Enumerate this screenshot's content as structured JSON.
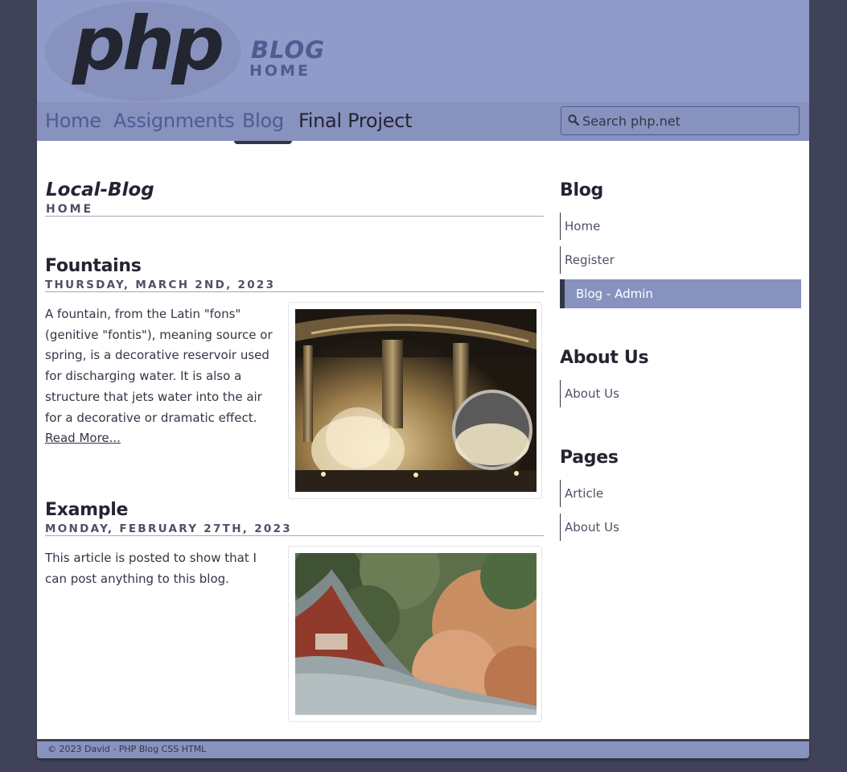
{
  "header": {
    "logo_text": "php",
    "title": "BLOG",
    "subtitle": "HOME"
  },
  "nav": {
    "items": [
      {
        "label": "Home"
      },
      {
        "label": "Assignments"
      },
      {
        "label": "Blog"
      },
      {
        "label": "Final Project"
      }
    ],
    "active": "Blog",
    "search_placeholder": "Search php.net"
  },
  "main": {
    "title": "Local-Blog",
    "subtitle": "HOME",
    "posts": [
      {
        "title": "Fountains",
        "date": "THURSDAY, MARCH 2ND, 2023",
        "excerpt": "A fountain, from the Latin \"fons\" (genitive \"fontis\"), meaning source or spring, is a decorative reservoir used for discharging water. It is also a structure that jets water into the air for a decorative or dramatic effect. ",
        "read_more": "Read More...",
        "image": "fountain-photo"
      },
      {
        "title": "Example",
        "date": "MONDAY, FEBRUARY 27TH, 2023",
        "excerpt": "This article is posted to show that I can post anything to this blog.",
        "image": "temple-roof-autumn-photo"
      }
    ]
  },
  "sidebar": {
    "sections": [
      {
        "heading": "Blog",
        "links": [
          {
            "label": "Home"
          },
          {
            "label": "Register"
          },
          {
            "label": "Blog - Admin",
            "active": true
          }
        ]
      },
      {
        "heading": "About Us",
        "links": [
          {
            "label": "About Us"
          }
        ]
      },
      {
        "heading": "Pages",
        "links": [
          {
            "label": "Article"
          },
          {
            "label": "About Us"
          }
        ]
      }
    ]
  },
  "footer": {
    "text": "© 2023 David - PHP Blog CSS HTML"
  },
  "colors": {
    "background": "#3f4259",
    "header": "#8f9bc8",
    "nav": "#8892bf",
    "accent": "#4f5b93",
    "text_dark": "#232531"
  }
}
